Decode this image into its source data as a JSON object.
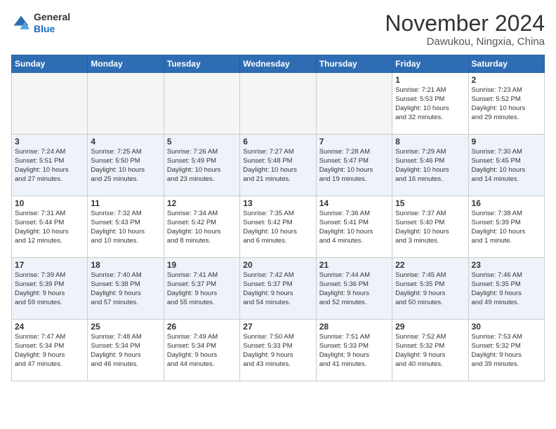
{
  "header": {
    "logo_line1": "General",
    "logo_line2": "Blue",
    "month": "November 2024",
    "location": "Dawukou, Ningxia, China"
  },
  "weekdays": [
    "Sunday",
    "Monday",
    "Tuesday",
    "Wednesday",
    "Thursday",
    "Friday",
    "Saturday"
  ],
  "weeks": [
    [
      {
        "day": "",
        "info": ""
      },
      {
        "day": "",
        "info": ""
      },
      {
        "day": "",
        "info": ""
      },
      {
        "day": "",
        "info": ""
      },
      {
        "day": "",
        "info": ""
      },
      {
        "day": "1",
        "info": "Sunrise: 7:21 AM\nSunset: 5:53 PM\nDaylight: 10 hours\nand 32 minutes."
      },
      {
        "day": "2",
        "info": "Sunrise: 7:23 AM\nSunset: 5:52 PM\nDaylight: 10 hours\nand 29 minutes."
      }
    ],
    [
      {
        "day": "3",
        "info": "Sunrise: 7:24 AM\nSunset: 5:51 PM\nDaylight: 10 hours\nand 27 minutes."
      },
      {
        "day": "4",
        "info": "Sunrise: 7:25 AM\nSunset: 5:50 PM\nDaylight: 10 hours\nand 25 minutes."
      },
      {
        "day": "5",
        "info": "Sunrise: 7:26 AM\nSunset: 5:49 PM\nDaylight: 10 hours\nand 23 minutes."
      },
      {
        "day": "6",
        "info": "Sunrise: 7:27 AM\nSunset: 5:48 PM\nDaylight: 10 hours\nand 21 minutes."
      },
      {
        "day": "7",
        "info": "Sunrise: 7:28 AM\nSunset: 5:47 PM\nDaylight: 10 hours\nand 19 minutes."
      },
      {
        "day": "8",
        "info": "Sunrise: 7:29 AM\nSunset: 5:46 PM\nDaylight: 10 hours\nand 16 minutes."
      },
      {
        "day": "9",
        "info": "Sunrise: 7:30 AM\nSunset: 5:45 PM\nDaylight: 10 hours\nand 14 minutes."
      }
    ],
    [
      {
        "day": "10",
        "info": "Sunrise: 7:31 AM\nSunset: 5:44 PM\nDaylight: 10 hours\nand 12 minutes."
      },
      {
        "day": "11",
        "info": "Sunrise: 7:32 AM\nSunset: 5:43 PM\nDaylight: 10 hours\nand 10 minutes."
      },
      {
        "day": "12",
        "info": "Sunrise: 7:34 AM\nSunset: 5:42 PM\nDaylight: 10 hours\nand 8 minutes."
      },
      {
        "day": "13",
        "info": "Sunrise: 7:35 AM\nSunset: 5:42 PM\nDaylight: 10 hours\nand 6 minutes."
      },
      {
        "day": "14",
        "info": "Sunrise: 7:36 AM\nSunset: 5:41 PM\nDaylight: 10 hours\nand 4 minutes."
      },
      {
        "day": "15",
        "info": "Sunrise: 7:37 AM\nSunset: 5:40 PM\nDaylight: 10 hours\nand 3 minutes."
      },
      {
        "day": "16",
        "info": "Sunrise: 7:38 AM\nSunset: 5:39 PM\nDaylight: 10 hours\nand 1 minute."
      }
    ],
    [
      {
        "day": "17",
        "info": "Sunrise: 7:39 AM\nSunset: 5:39 PM\nDaylight: 9 hours\nand 59 minutes."
      },
      {
        "day": "18",
        "info": "Sunrise: 7:40 AM\nSunset: 5:38 PM\nDaylight: 9 hours\nand 57 minutes."
      },
      {
        "day": "19",
        "info": "Sunrise: 7:41 AM\nSunset: 5:37 PM\nDaylight: 9 hours\nand 55 minutes."
      },
      {
        "day": "20",
        "info": "Sunrise: 7:42 AM\nSunset: 5:37 PM\nDaylight: 9 hours\nand 54 minutes."
      },
      {
        "day": "21",
        "info": "Sunrise: 7:44 AM\nSunset: 5:36 PM\nDaylight: 9 hours\nand 52 minutes."
      },
      {
        "day": "22",
        "info": "Sunrise: 7:45 AM\nSunset: 5:35 PM\nDaylight: 9 hours\nand 50 minutes."
      },
      {
        "day": "23",
        "info": "Sunrise: 7:46 AM\nSunset: 5:35 PM\nDaylight: 9 hours\nand 49 minutes."
      }
    ],
    [
      {
        "day": "24",
        "info": "Sunrise: 7:47 AM\nSunset: 5:34 PM\nDaylight: 9 hours\nand 47 minutes."
      },
      {
        "day": "25",
        "info": "Sunrise: 7:48 AM\nSunset: 5:34 PM\nDaylight: 9 hours\nand 46 minutes."
      },
      {
        "day": "26",
        "info": "Sunrise: 7:49 AM\nSunset: 5:34 PM\nDaylight: 9 hours\nand 44 minutes."
      },
      {
        "day": "27",
        "info": "Sunrise: 7:50 AM\nSunset: 5:33 PM\nDaylight: 9 hours\nand 43 minutes."
      },
      {
        "day": "28",
        "info": "Sunrise: 7:51 AM\nSunset: 5:33 PM\nDaylight: 9 hours\nand 41 minutes."
      },
      {
        "day": "29",
        "info": "Sunrise: 7:52 AM\nSunset: 5:32 PM\nDaylight: 9 hours\nand 40 minutes."
      },
      {
        "day": "30",
        "info": "Sunrise: 7:53 AM\nSunset: 5:32 PM\nDaylight: 9 hours\nand 39 minutes."
      }
    ]
  ]
}
